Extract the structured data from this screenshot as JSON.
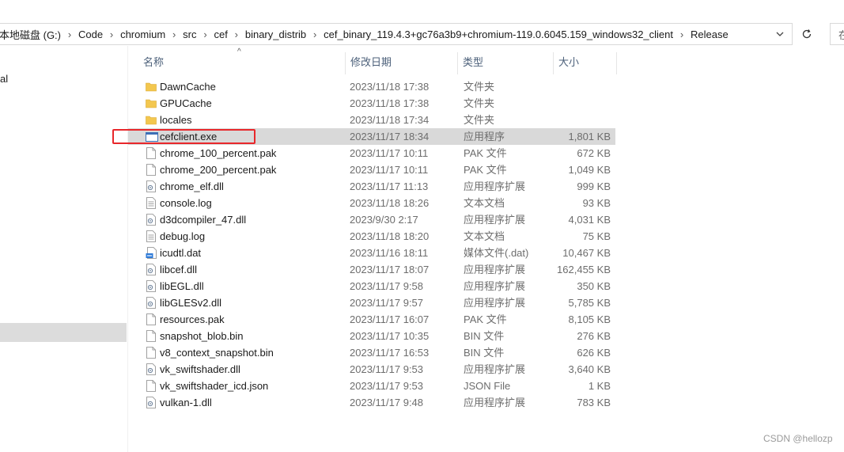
{
  "address_bar": {
    "crumbs": [
      "本地磁盘 (G:)",
      "Code",
      "chromium",
      "src",
      "cef",
      "binary_distrib",
      "cef_binary_119.4.3+gc76a3b9+chromium-119.0.6045.159_windows32_client",
      "Release"
    ],
    "separator": "›",
    "dropdown_glyph": "⌄",
    "refresh_glyph": "↻"
  },
  "search": {
    "placeholder": "在"
  },
  "nav": {
    "partial_item": "al"
  },
  "columns": {
    "name": "名称",
    "date": "修改日期",
    "type": "类型",
    "size": "大小"
  },
  "sort_indicator": "^",
  "files": [
    {
      "name": "DawnCache",
      "date": "2023/11/18 17:38",
      "type": "文件夹",
      "size": "",
      "icon": "folder-icon"
    },
    {
      "name": "GPUCache",
      "date": "2023/11/18 17:38",
      "type": "文件夹",
      "size": "",
      "icon": "folder-icon"
    },
    {
      "name": "locales",
      "date": "2023/11/18 17:34",
      "type": "文件夹",
      "size": "",
      "icon": "folder-icon"
    },
    {
      "name": "cefclient.exe",
      "date": "2023/11/17 18:34",
      "type": "应用程序",
      "size": "1,801 KB",
      "icon": "exe-icon",
      "selected": true
    },
    {
      "name": "chrome_100_percent.pak",
      "date": "2023/11/17 10:11",
      "type": "PAK 文件",
      "size": "672 KB",
      "icon": "file-icon"
    },
    {
      "name": "chrome_200_percent.pak",
      "date": "2023/11/17 10:11",
      "type": "PAK 文件",
      "size": "1,049 KB",
      "icon": "file-icon"
    },
    {
      "name": "chrome_elf.dll",
      "date": "2023/11/17 11:13",
      "type": "应用程序扩展",
      "size": "999 KB",
      "icon": "dll-icon"
    },
    {
      "name": "console.log",
      "date": "2023/11/18 18:26",
      "type": "文本文档",
      "size": "93 KB",
      "icon": "text-file-icon"
    },
    {
      "name": "d3dcompiler_47.dll",
      "date": "2023/9/30 2:17",
      "type": "应用程序扩展",
      "size": "4,031 KB",
      "icon": "dll-icon"
    },
    {
      "name": "debug.log",
      "date": "2023/11/18 18:20",
      "type": "文本文档",
      "size": "75 KB",
      "icon": "text-file-icon"
    },
    {
      "name": "icudtl.dat",
      "date": "2023/11/16 18:11",
      "type": "媒体文件(.dat)",
      "size": "10,467 KB",
      "icon": "media-file-icon"
    },
    {
      "name": "libcef.dll",
      "date": "2023/11/17 18:07",
      "type": "应用程序扩展",
      "size": "162,455 KB",
      "icon": "dll-icon"
    },
    {
      "name": "libEGL.dll",
      "date": "2023/11/17 9:58",
      "type": "应用程序扩展",
      "size": "350 KB",
      "icon": "dll-icon"
    },
    {
      "name": "libGLESv2.dll",
      "date": "2023/11/17 9:57",
      "type": "应用程序扩展",
      "size": "5,785 KB",
      "icon": "dll-icon"
    },
    {
      "name": "resources.pak",
      "date": "2023/11/17 16:07",
      "type": "PAK 文件",
      "size": "8,105 KB",
      "icon": "file-icon"
    },
    {
      "name": "snapshot_blob.bin",
      "date": "2023/11/17 10:35",
      "type": "BIN 文件",
      "size": "276 KB",
      "icon": "file-icon"
    },
    {
      "name": "v8_context_snapshot.bin",
      "date": "2023/11/17 16:53",
      "type": "BIN 文件",
      "size": "626 KB",
      "icon": "file-icon"
    },
    {
      "name": "vk_swiftshader.dll",
      "date": "2023/11/17 9:53",
      "type": "应用程序扩展",
      "size": "3,640 KB",
      "icon": "dll-icon"
    },
    {
      "name": "vk_swiftshader_icd.json",
      "date": "2023/11/17 9:53",
      "type": "JSON File",
      "size": "1 KB",
      "icon": "file-icon"
    },
    {
      "name": "vulkan-1.dll",
      "date": "2023/11/17 9:48",
      "type": "应用程序扩展",
      "size": "783 KB",
      "icon": "dll-icon"
    }
  ],
  "colors": {
    "highlight": "#e8272b",
    "folder": "#f3c74f",
    "selection": "#d9d9d9"
  },
  "watermark": "CSDN @hellozp"
}
